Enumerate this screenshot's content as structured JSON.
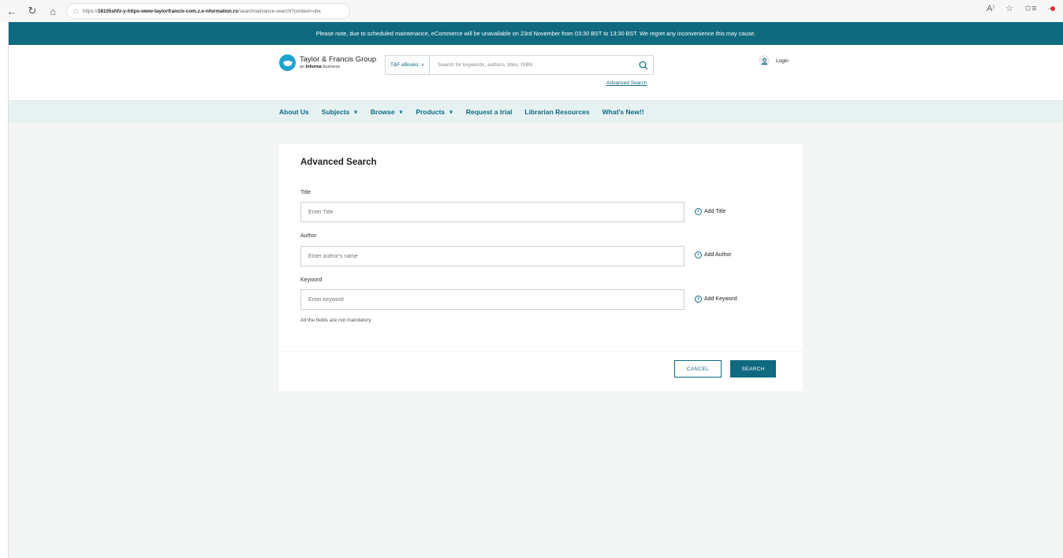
{
  "browser": {
    "url_prefix": "https://",
    "url_host": "18105shfz-y-https-www-taylorfrancis-com.z.e-nformation.ro",
    "url_path": "/search/advance-search?context=ubx",
    "back_icon": "back-arrow-icon",
    "reload_icon": "reload-icon",
    "home_icon": "home-icon"
  },
  "banner": {
    "text": "Please note, due to scheduled maintenance, eCommerce will be unavailable on 23rd November from 03:30 BST to 13:30 BST. We regret any inconvenience this may cause."
  },
  "header": {
    "logo_name": "Taylor & Francis Group",
    "logo_sub_prefix": "an ",
    "logo_sub_brand": "informa",
    "logo_sub_suffix": " business",
    "search_category": "T&F eBooks",
    "search_placeholder": "Search for keywords, authors, titles, ISBN",
    "advanced_search_link": "Advanced Search",
    "login_label": "Login"
  },
  "nav": {
    "items": [
      {
        "label": "About Us"
      },
      {
        "label": "Subjects"
      },
      {
        "label": "Browse"
      },
      {
        "label": "Products"
      },
      {
        "label": "Request a trial"
      },
      {
        "label": "Librarian Resources"
      },
      {
        "label": "What's New!!"
      }
    ]
  },
  "form": {
    "title": "Advanced Search",
    "fields": [
      {
        "label": "Title",
        "placeholder": "Enter Title",
        "add_label": "Add Title"
      },
      {
        "label": "Author",
        "placeholder": "Enter author's name",
        "add_label": "Add Author"
      },
      {
        "label": "Keyword",
        "placeholder": "Enter keyword",
        "add_label": "Add Keyword"
      }
    ],
    "hint": "All the fields are not mandatory",
    "cancel_label": "CANCEL",
    "search_label": "SEARCH"
  },
  "colors": {
    "brand_teal": "#0f6a80",
    "logo_blue": "#1aa3cf",
    "nav_bg": "#e6f1f2",
    "page_bg": "#f4f6f6"
  }
}
